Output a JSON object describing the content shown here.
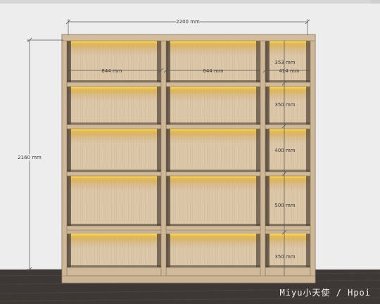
{
  "dimensions": {
    "total_width": "2200 mm",
    "total_height": "2160 mm",
    "bay_left_width": "844 mm",
    "bay_middle_width": "844 mm",
    "bay_right_width": "414 mm",
    "shelf_gap_1": "353 mm",
    "shelf_gap_2": "350 mm",
    "shelf_gap_3": "400 mm",
    "shelf_gap_4": "500 mm",
    "shelf_gap_5": "350 mm"
  },
  "watermark": "Miyu小天使 / Hpoi",
  "colors": {
    "wall": "#ededed",
    "floor": "#3d3835",
    "wood": "#d8c3a6",
    "panel_edge": "#a08f79",
    "led_glow": "#f2c230",
    "dimension_line": "#555555"
  }
}
